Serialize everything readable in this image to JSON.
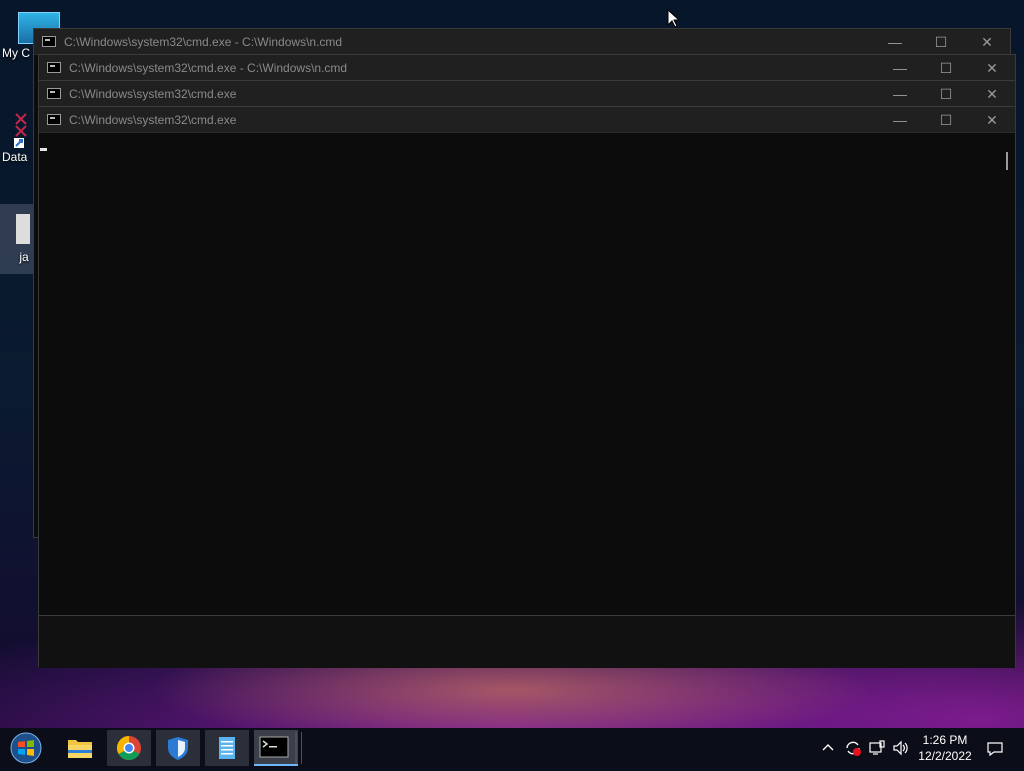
{
  "desktop": {
    "icons": [
      {
        "label": "My C"
      },
      {
        "label": "Data"
      },
      {
        "label": "ja"
      }
    ]
  },
  "windows": [
    {
      "title": "C:\\Windows\\system32\\cmd.exe - C:\\Windows\\n.cmd"
    },
    {
      "title": "C:\\Windows\\system32\\cmd.exe - C:\\Windows\\n.cmd"
    },
    {
      "title": "C:\\Windows\\system32\\cmd.exe"
    },
    {
      "title": "C:\\Windows\\system32\\cmd.exe"
    }
  ],
  "window_controls": {
    "minimize": "—",
    "maximize": "☐",
    "close": "✕"
  },
  "taskbar": {
    "apps": [
      "start-button",
      "file-explorer",
      "chrome",
      "windows-security",
      "notepad",
      "command-prompt"
    ],
    "tray": {
      "time": "1:26 PM",
      "date": "12/2/2022"
    }
  },
  "colors": {
    "titlebar": "#202020",
    "console": "#0c0c0c",
    "accent": "#6cb8ff"
  }
}
